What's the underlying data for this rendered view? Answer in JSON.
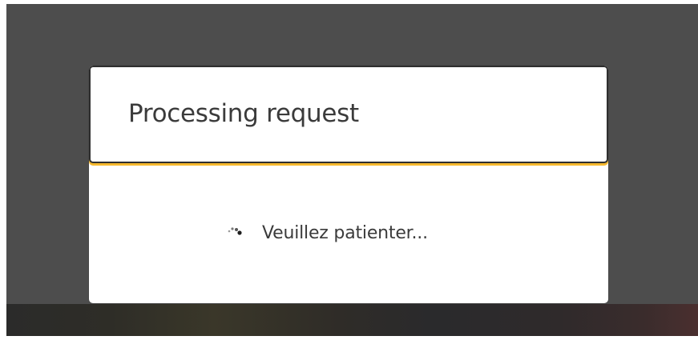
{
  "dialog": {
    "title": "Processing request",
    "loading_text": "Veuillez patienter..."
  },
  "icons": {
    "spinner": "spinner-icon"
  },
  "colors": {
    "overlay": "#4d4d4d",
    "header_accent": "#f5b82e",
    "text": "#3b3b3b"
  }
}
